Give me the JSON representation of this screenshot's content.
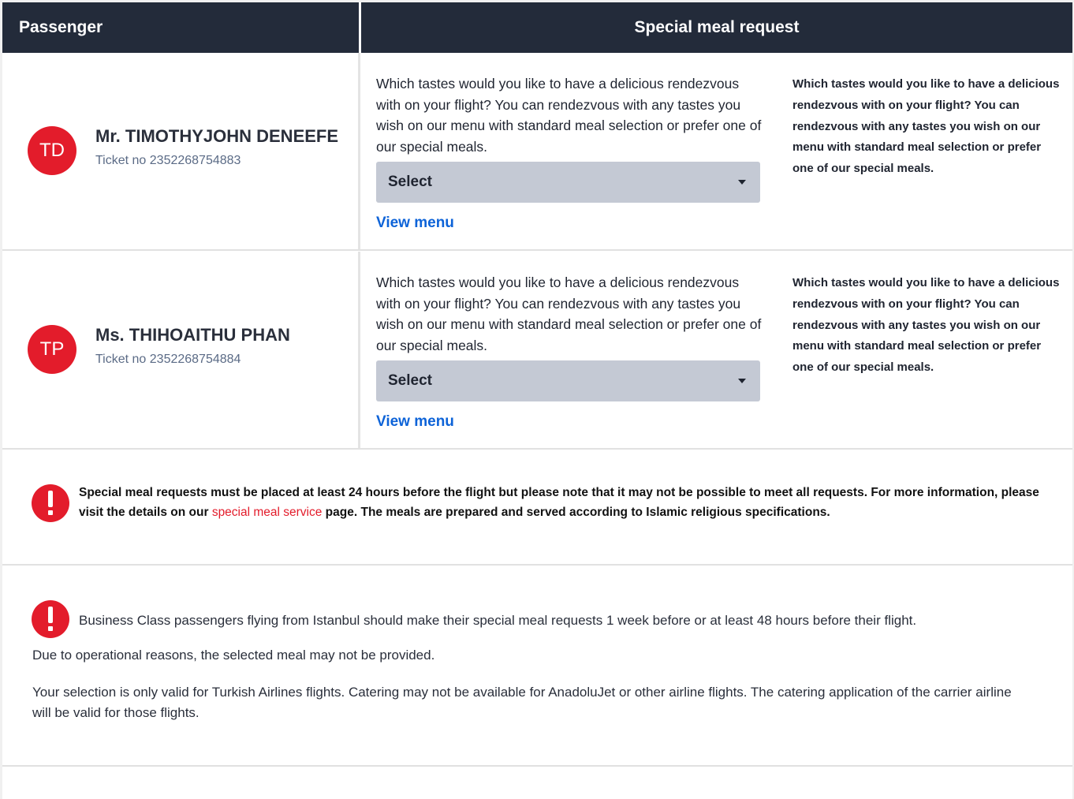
{
  "header": {
    "passenger_label": "Passenger",
    "meal_label": "Special meal request"
  },
  "passengers": [
    {
      "initials": "TD",
      "name": "Mr. TIMOTHYJOHN DENEEFE",
      "ticket": "Ticket no 2352268754883",
      "meal_description": "Which tastes would you like to have a delicious rendezvous with on your flight? You can rendezvous with any tastes you wish on our menu with standard meal selection or prefer one of our special meals.",
      "select_value": "Select",
      "view_menu_label": "View menu",
      "aside_description": "Which tastes would you like to have a delicious rendezvous with on your flight? You can rendezvous with any tastes you wish on our menu with standard meal selection or prefer one of our special meals."
    },
    {
      "initials": "TP",
      "name": "Ms. THIHOAITHU PHAN",
      "ticket": "Ticket no 2352268754884",
      "meal_description": "Which tastes would you like to have a delicious rendezvous with on your flight? You can rendezvous with any tastes you wish on our menu with standard meal selection or prefer one of our special meals.",
      "select_value": "Select",
      "view_menu_label": "View menu",
      "aside_description": "Which tastes would you like to have a delicious rendezvous with on your flight? You can rendezvous with any tastes you wish on our menu with standard meal selection or prefer one of our special meals."
    }
  ],
  "notice_1": {
    "icon": "exclamation-circle-icon",
    "text_before": "Special meal requests must be placed at least 24 hours before the flight but please note that it may not be possible to meet all requests. For more information, please visit the details on our ",
    "link_text": "special meal service",
    "text_after": " page. The meals are prepared and served according to Islamic religious specifications."
  },
  "notice_2": {
    "icon": "exclamation-circle-icon",
    "line1": "Business Class passengers flying from Istanbul should make their special meal requests 1 week before or at least 48 hours before their flight.",
    "line2": "Due to operational reasons, the selected meal may not be provided.",
    "line3": "Your selection is only valid for Turkish Airlines flights. Catering may not be available for AnadoluJet or other airline flights. The catering application of the carrier airline will be valid for those flights."
  },
  "colors": {
    "header_bg": "#232b3a",
    "brand_red": "#e31c2b",
    "select_bg": "#c4c9d4",
    "link_blue": "#0d63d8"
  }
}
